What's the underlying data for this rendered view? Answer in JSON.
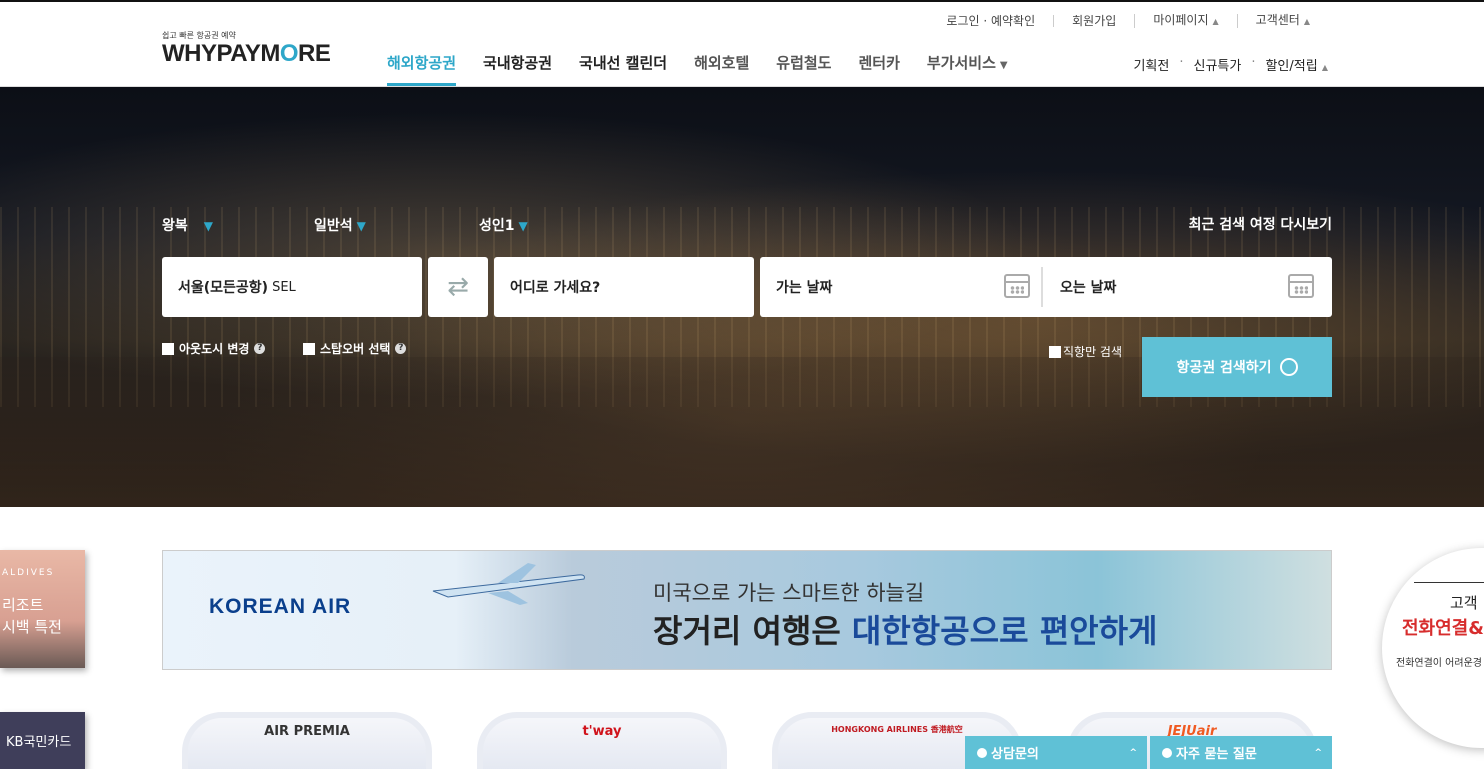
{
  "header": {
    "logo_tagline": "쉽고 빠른 항공권 예약",
    "logo_prefix": "WHYPAYM",
    "logo_o": "O",
    "logo_suffix": "RE",
    "util": [
      "로그인 · 예약확인",
      "회원가입",
      "마이페이지",
      "고객센터"
    ],
    "nav": [
      "해외항공권",
      "국내항공권",
      "국내선 캘린더",
      "해외호텔",
      "유럽철도",
      "렌터카",
      "부가서비스"
    ],
    "subnav": [
      "기획전",
      "신규특가",
      "할인/적립"
    ]
  },
  "search": {
    "trip_type": "왕복",
    "cabin": "일반석",
    "passengers": "성인1",
    "recent": "최근 검색 여정 다시보기",
    "origin": "서울(모든공항)",
    "origin_code": "SEL",
    "destination_placeholder": "어디로 가세요?",
    "depart_label": "가는 날짜",
    "return_label": "오는 날짜",
    "opt_out_city": "아웃도시 변경",
    "opt_stopover": "스탑오버 선택",
    "opt_direct": "직항만 검색",
    "submit": "항공권 검색하기"
  },
  "banner": {
    "brand": "KOREAN AIR",
    "line1": "미국으로 가는 스마트한 하늘길",
    "line2_a": "장거리 여행은 ",
    "line2_b": "대한항공으로 편안하게"
  },
  "side": {
    "promo_1": "ALDIVES",
    "promo_2": "리조트",
    "promo_3": "시백 특전",
    "card": "KB국민카드"
  },
  "airlines": [
    "AIR PREMIA",
    "t'way",
    "HONGKONG AIRLINES 香港航空",
    "JEJUair"
  ],
  "floating": {
    "consult": "상담문의",
    "faq": "자주 묻는 질문",
    "cs_title": "고객",
    "cs_phone": "전화연결&",
    "cs_note": "전화연결이 어려운경"
  }
}
